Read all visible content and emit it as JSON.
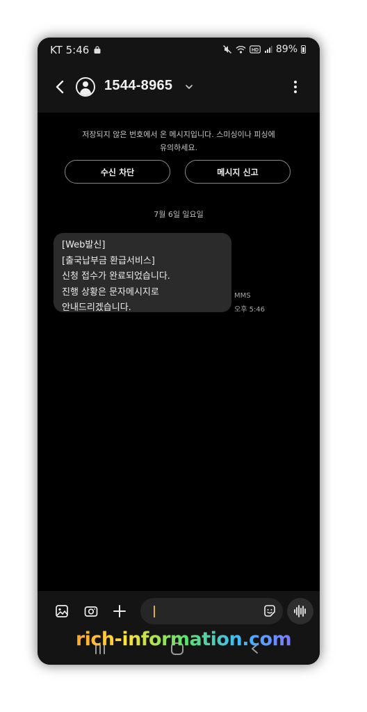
{
  "status_bar": {
    "carrier_time": "KT 5:46",
    "battery": "89%",
    "icons": [
      "shopping-bag-icon",
      "mute-icon",
      "wifi-icon",
      "hd-icon",
      "signal-icon",
      "battery-icon"
    ]
  },
  "header": {
    "contact_name": "1544-8965",
    "icons": [
      "back-arrow-icon",
      "contact-avatar-icon",
      "chevron-down-icon",
      "more-options-icon"
    ]
  },
  "notice": {
    "line1": "저장되지 않은 번호에서 온 메시지입니다. 스미싱이나 피싱에",
    "line2": "유의하세요."
  },
  "actions": {
    "block_label": "수신 차단",
    "report_label": "메시지 신고"
  },
  "conversation": {
    "date_label": "7월 6일 일요일",
    "message": {
      "lines": [
        "[Web발신]",
        "[출국납부금 환급서비스]",
        "신청 접수가 완료되었습니다.",
        "진행 상황은 문자메시지로",
        "안내드리겠습니다."
      ],
      "type": "MMS",
      "time": "오후 5:46"
    }
  },
  "composer": {
    "input_value": "",
    "icons": [
      "gallery-icon",
      "camera-icon",
      "plus-icon",
      "sticker-icon",
      "voice-wave-icon"
    ]
  },
  "watermark": {
    "text": "rich-information.com"
  },
  "colors": {
    "background": "#000000",
    "bar": "#141414",
    "bubble": "#2b2b2b",
    "cursor": "#e0b030"
  }
}
